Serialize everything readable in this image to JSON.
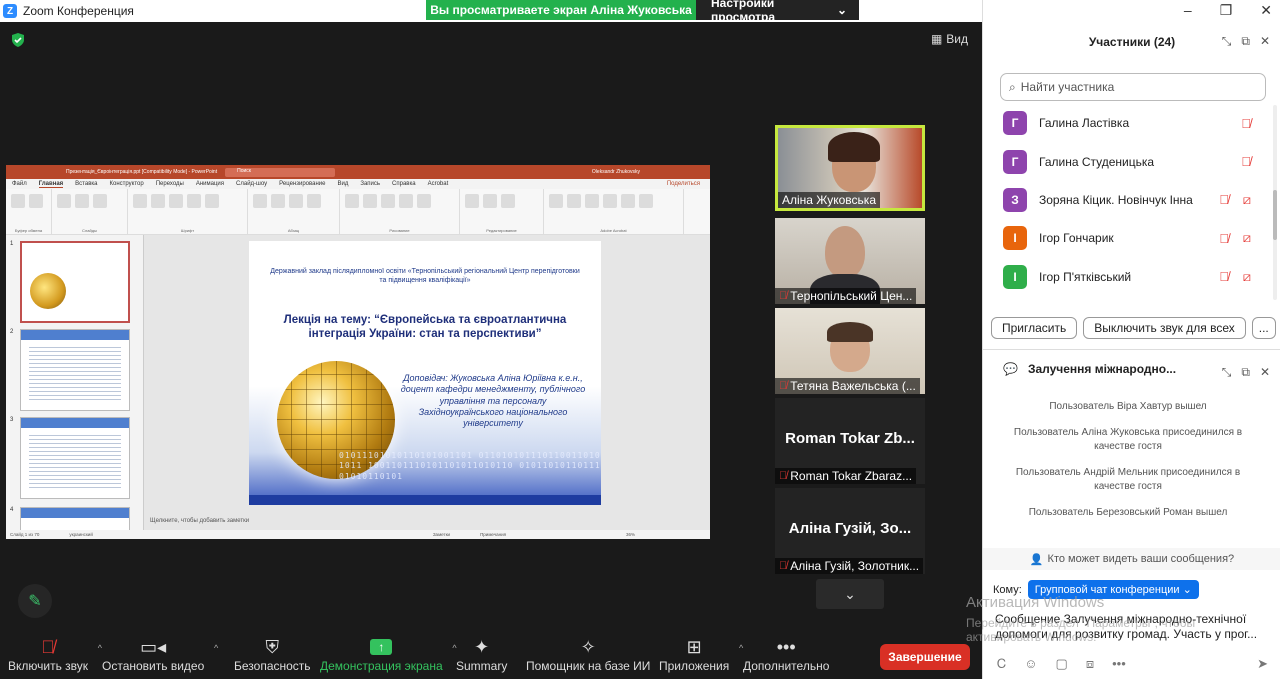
{
  "window": {
    "title": "Zoom Конференция"
  },
  "banner": {
    "sharing_text": "Вы просматриваете экран Аліна Жуковська",
    "view_options": "Настройки просмотра"
  },
  "meeting": {
    "view_label": "Вид"
  },
  "ppt": {
    "title": "Презентація_Євроінтеграція.ppt [Compatibility Mode] - PowerPoint",
    "search": "Поиск",
    "user": "Oleksandr Zhukovsky",
    "tabs": [
      "Файл",
      "Главная",
      "Вставка",
      "Конструктор",
      "Переходы",
      "Анимация",
      "Слайд-шоу",
      "Рецензирование",
      "Вид",
      "Запись",
      "Справка",
      "Acrobat"
    ],
    "share_label": "Поделиться",
    "groups": [
      "Буфер обмена",
      "Слайды",
      "Шрифт",
      "Абзац",
      "Рисование",
      "Редактирование",
      "Adobe Acrobat"
    ],
    "slide_numbers": [
      "1",
      "2",
      "3",
      "4"
    ],
    "slide": {
      "org": "Державний заклад післядипломної освіти «Тернопільський регіональний Центр перепідготовки та підвищення кваліфікації»",
      "lecture": "Лекція на тему: “Європейська та євроатлантична інтеграція України: стан та перспективи”",
      "speaker": "Доповідач: Жуковська Аліна Юріївна к.е.н., доцент кафедри менеджменту, публічного управління та персоналу Західноукраїнського національного університету",
      "binary": "01011101010110101001101 0110101011101100110101011 1001101110101101011010110 0101101011011101010110101"
    },
    "notes_placeholder": "Щелкните, чтобы добавить заметки",
    "status_slide": "Слайд 1 из 70",
    "status_lang": "украинский",
    "status_notes": "Заметки",
    "status_comments": "Примечания",
    "status_zoom": "36%"
  },
  "videos": [
    {
      "name": "Аліна Жуковська",
      "muted": false,
      "active": true
    },
    {
      "name": "Тернопільський Цен...",
      "muted": true
    },
    {
      "name": "Тетяна Важельська (...",
      "muted": true
    },
    {
      "name": "Roman Tokar Zbaraz...",
      "bigname": "Roman Tokar Zb...",
      "muted": true
    },
    {
      "name": "Аліна Гузій, Золотник...",
      "bigname": "Аліна Гузій, Зо...",
      "muted": true
    }
  ],
  "toolbar": {
    "unmute": "Включить звук",
    "video": "Остановить видео",
    "security": "Безопасность",
    "share": "Демонстрация экрана",
    "summary": "Summary",
    "ai": "Помощник на базе ИИ",
    "apps": "Приложения",
    "more": "Дополнительно",
    "end": "Завершение"
  },
  "participants": {
    "header": "Участники (24)",
    "search_placeholder": "Найти участника",
    "list": [
      {
        "initial": "Г",
        "name": "Галина Ластівка",
        "color": "#8e44ad"
      },
      {
        "initial": "Г",
        "name": "Галина Студеницька",
        "color": "#8e44ad"
      },
      {
        "initial": "З",
        "name": "Зоряна Кіцик. Новінчук Інна",
        "color": "#8e44ad"
      },
      {
        "initial": "І",
        "name": "Ігор Гончарик",
        "color": "#e8650c"
      },
      {
        "initial": "І",
        "name": "Ігор П'ятківський",
        "color": "#2fae4a"
      }
    ],
    "invite": "Пригласить",
    "mute_all": "Выключить звук для всех",
    "more": "..."
  },
  "chat": {
    "title": "Залучення міжнародно...",
    "messages": [
      "Пользователь Віра Хавтур вышел",
      "Пользователь Аліна Жуковська присоединился в качестве гостя",
      "Пользователь Андрій Мельник присоединился в качестве гостя",
      "Пользователь Березовський Роман вышел"
    ],
    "who_sees": "Кто может видеть ваши сообщения?",
    "to_label": "Кому:",
    "to_value": "Групповой чат конференции",
    "compose": "Сообщение Залучення міжнародно-технічної допомоги для розвитку громад. Участь у прог...",
    "activation_title": "Активация Windows",
    "activation_sub": "Перейдите в раздел \"Параметры\", чтобы активировать Windows."
  }
}
